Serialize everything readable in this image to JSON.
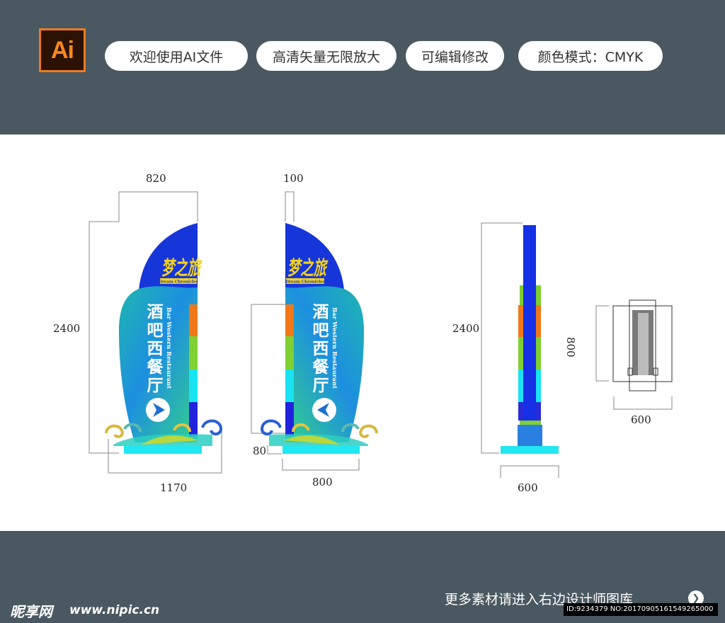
{
  "header": {
    "ai_logo": "Ai",
    "tags": [
      "欢迎使用AI文件",
      "高清矢量无限放大",
      "可编辑修改",
      "颜色模式：CMYK"
    ]
  },
  "sign": {
    "brand_cn": "梦之旅",
    "brand_en": "Dream Chronicles",
    "title_cn_lines": [
      "酒",
      "吧",
      "西",
      "餐",
      "厅"
    ],
    "title_en": "Bar Western Restaurant"
  },
  "dimensions": {
    "front_width": "820",
    "front_height": "2400",
    "front_base": "1170",
    "back_top": "100",
    "back_base_height": "80",
    "back_base": "800",
    "side_height": "2400",
    "side_base": "600",
    "plan_height": "800",
    "plan_width": "600"
  },
  "footer": {
    "site_logo": "昵享网",
    "site_url": "www.nipic.cn",
    "more_text": "更多素材请进入右边设计师图库",
    "id_text": "ID:9234379 NO:20170905161549265000"
  },
  "colors": {
    "band": "#4a5861",
    "sail_blue": "#1636d9",
    "brand_yellow": "#f5d21a",
    "bar_orange": "#f07818",
    "bar_green": "#7fd032",
    "bar_cyan": "#19e3f2",
    "bar_blue": "#2222dd",
    "base_cyan": "#22e6f0"
  }
}
